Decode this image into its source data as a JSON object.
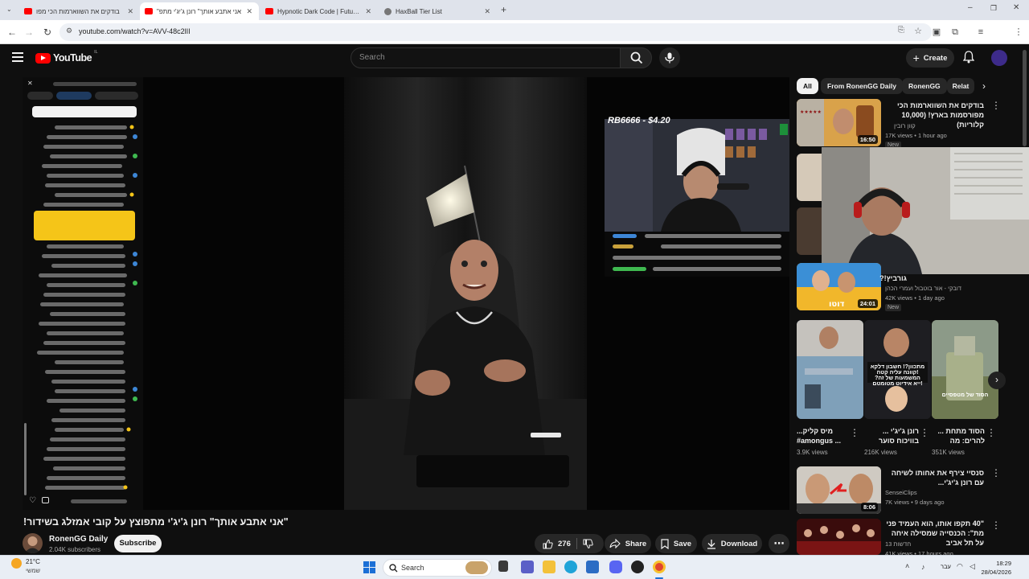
{
  "browser": {
    "tabs": [
      {
        "title": "בודקים את השווארמות הכי מפו",
        "active": false,
        "favicon": "youtube-icon"
      },
      {
        "title": "\"אני אתבע אותך\" רונן ג'יג'י מתפ",
        "active": true,
        "favicon": "youtube-icon"
      },
      {
        "title": "Hypnotic Dark Code | Futuristic",
        "active": false,
        "favicon": "youtube-icon"
      },
      {
        "title": "HaxBall Tier List",
        "active": false,
        "favicon": "globe-icon"
      }
    ],
    "url": "youtube.com/watch?v=AVV-48c2lII"
  },
  "youtube": {
    "logo": "YouTube",
    "region": "IL",
    "search_placeholder": "Search",
    "create_label": "Create"
  },
  "video": {
    "overlay_title": "RB6666 - $4.20",
    "title": "\"אני אתבע אותך\" רונן ג'יג'י מתפוצץ על קובי אמזלג בשידור!",
    "channel": "RonenGG Daily",
    "subscribers": "2.04K subscribers",
    "subscribe_label": "Subscribe",
    "likes": "276",
    "share_label": "Share",
    "save_label": "Save",
    "download_label": "Download"
  },
  "sidebar": {
    "chips": [
      "All",
      "From RonenGG Daily",
      "RonenGG",
      "Relat"
    ],
    "videos": [
      {
        "title": "בודקים את השווארמות הכי מפורסמות בארץ! (10,000 קלוריות)",
        "channel": "קוון רובין",
        "meta": "17K views • 1 hour ago",
        "badge": "New",
        "duration": "16:50"
      },
      {
        "title": "גורביץ!?",
        "channel": "דובקי - אור בוטבול ועמרי הכהן",
        "meta": "42K views • 1 day ago",
        "badge": "New",
        "duration": "24:01"
      },
      {
        "title": "סנסיי צירף את אחותו לשיחה עם רונן ג'יג'י...",
        "channel": "SenseiClips",
        "meta": "7K views • 9 days ago",
        "badge": "",
        "duration": "8:06"
      },
      {
        "title": "\"40 תקפו אותו, הוא העמיד פני מת\": הכנסייה שמסילה איחה על תל אביב",
        "channel": "חדשות 13",
        "meta": "41K views • 17 hours ago",
        "badge": "",
        "duration": ""
      }
    ],
    "shorts": [
      {
        "title": "...מיס קליק #amongus ...",
        "views": "3.9K views"
      },
      {
        "title": "רונן ג'יג'י ... בוויכוח סוער",
        "views": "216K views"
      },
      {
        "title": "הסוד מתחת ... להרים: מה",
        "views": "351K views"
      }
    ],
    "short_overlays": [
      "מתכוון?! חשבון דלקא",
      "!קוונה עליה קטה",
      "המשמעות של זה?",
      "!ייא אידיוט מטומטם",
      "הסוד של מטפסיים"
    ]
  },
  "taskbar": {
    "temperature": "21°C",
    "weather": "שמשי",
    "search_label": "Search",
    "language": "עבר",
    "time": "18:29",
    "date": "28/04/2026"
  },
  "colors": {
    "yt_red": "#ff0000",
    "bg": "#0f0f0f",
    "chip_bg": "#272727"
  }
}
